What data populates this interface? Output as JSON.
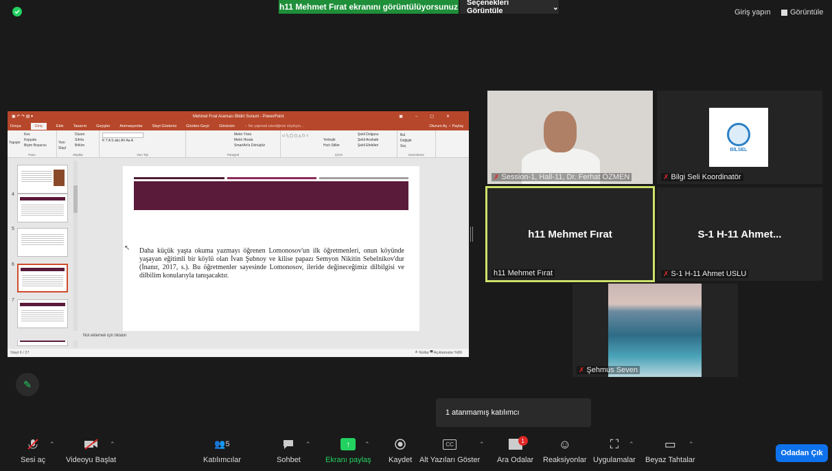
{
  "top": {
    "share_banner": "h11 Mehmet Fırat ekranını görüntülüyorsunuz",
    "options": "Seçenekleri Görüntüle",
    "signin": "Giriş yapın",
    "view": "Görüntüle"
  },
  "ppt": {
    "title": "Mehmet Fırat Aramacı Bildiri Sunum - PowerPoint",
    "tabs": [
      "Dosya",
      "Giriş",
      "Ekle",
      "Tasarım",
      "Geçişler",
      "Animasyonlar",
      "Slayt Gösterisi",
      "Gözden Geçir",
      "Görünüm",
      "♀ Ne yapmak istediğinizi söyleyin..."
    ],
    "tabs_right": "Oturum Aç  ♀ Paylaş",
    "ribbon": {
      "pano": [
        "Kes",
        "Kopyala",
        "Biçim Boyacısı"
      ],
      "pano_main": "Yapıştır",
      "pano_label": "Pano",
      "slides": [
        "Düzen",
        "Sıfırla",
        "Bölüm"
      ],
      "slides_main": "Yeni Slayt",
      "slides_label": "Slaytlar",
      "font_label": "Yazı Tipi",
      "para": [
        "Metin Yönü",
        "Metni Hizala",
        "SmartArt'a Dönüştür"
      ],
      "para_label": "Paragraf",
      "draw": [
        "Yerleştir",
        "Hızlı Stiller"
      ],
      "draw_fx": [
        "Şekil Dolgusu",
        "Şekil Anahattı",
        "Şekil Efektleri"
      ],
      "draw_label": "Çizim",
      "edit": [
        "Bul",
        "Değiştir",
        "Seç"
      ],
      "edit_label": "Düzenleme"
    },
    "thumb_numbers": [
      "4",
      "5",
      "6",
      "7",
      "8"
    ],
    "slide_text": "Daha küçük yaşta okuma yazmayı öğrenen Lomonosov'un ilk öğretmenleri, onun köyünde yaşayan eğitimli bir köylü olan İvan Şubnoy ve kilise papazı Semyon Nikitin Sebelnikov'dur (İnanır, 2017, s.). Bu öğretmenler sayesinde Lomonosov, ileride değineceğimiz dilbilgisi ve dilbilim konularıyla tanışacaktır.",
    "notes_placeholder": "Not eklemek için tıklatın",
    "status_left": "Slayt 6 / 27",
    "status_right": "≜ Notlar   ▀ Açıklamalar      %89"
  },
  "tiles": [
    {
      "name": "Session-1, Hall-11, Dr. Ferhat ÖZMEN",
      "muted": true
    },
    {
      "name": "Bilgi Seli Koordinatör",
      "muted": true,
      "logo_text": "BİLSEL"
    },
    {
      "name": "h11 Mehmet Fırat",
      "big": "h11 Mehmet Fırat",
      "muted": false
    },
    {
      "name": "S-1 H-11 Ahmet USLU",
      "big": "S-1 H-11 Ahmet...",
      "muted": true
    },
    {
      "name": "Şehmus Seven",
      "muted": true
    }
  ],
  "tooltip": "1 atanmamış katılımcı",
  "toolbar": {
    "audio": "Sesi aç",
    "video": "Videoyu Başlat",
    "participants": "Katılımcılar",
    "participants_count": "5",
    "chat": "Sohbet",
    "share": "Ekranı paylaş",
    "record": "Kaydet",
    "captions": "Alt Yazıları Göster",
    "cc": "CC",
    "rooms": "Ara Odalar",
    "rooms_badge": "1",
    "reactions": "Reaksiyonlar",
    "apps": "Uygulamalar",
    "whiteboard": "Beyaz Tahtalar",
    "leave": "Odadan Çık"
  }
}
